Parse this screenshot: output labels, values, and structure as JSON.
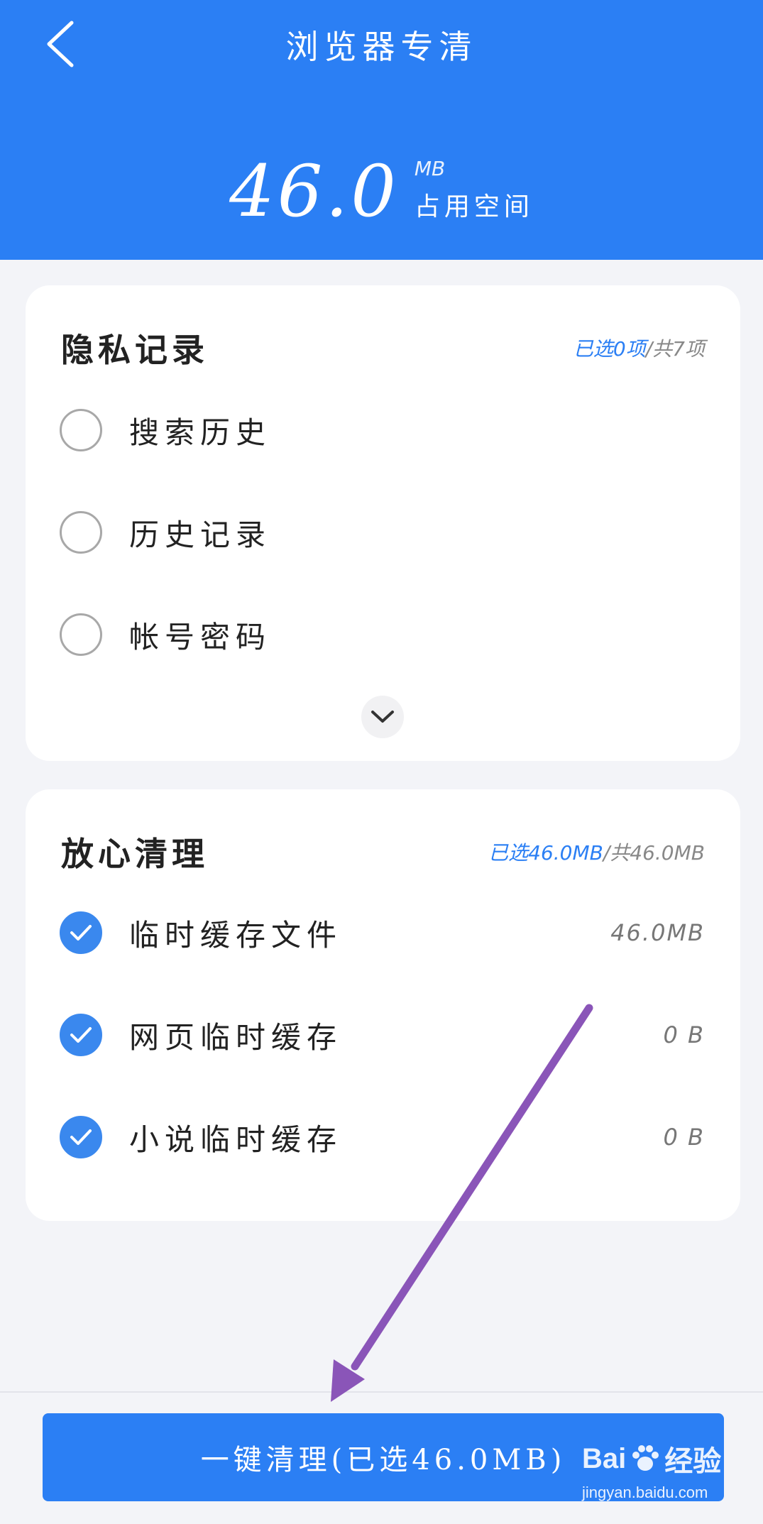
{
  "header": {
    "title": "浏览器专清",
    "size_value": "46.0",
    "size_unit": "MB",
    "size_label": "占用空间"
  },
  "privacy": {
    "title": "隐私记录",
    "selected_text": "已选0项",
    "total_text": "/共7项",
    "items": [
      {
        "label": "搜索历史",
        "checked": false
      },
      {
        "label": "历史记录",
        "checked": false
      },
      {
        "label": "帐号密码",
        "checked": false
      }
    ]
  },
  "clean": {
    "title": "放心清理",
    "selected_text": "已选46.0MB",
    "total_text": "/共46.0MB",
    "items": [
      {
        "label": "临时缓存文件",
        "size": "46.0MB",
        "checked": true
      },
      {
        "label": "网页临时缓存",
        "size": "0 B",
        "checked": true
      },
      {
        "label": "小说临时缓存",
        "size": "0 B",
        "checked": true
      }
    ]
  },
  "action": {
    "clean_button_label": "一键清理(已选46.0MB)"
  },
  "watermark": {
    "brand": "Bai",
    "brand_suffix": "经验",
    "url": "jingyan.baidu.com"
  },
  "colors": {
    "primary": "#2b7ff4",
    "check_on": "#3a88ee",
    "annotation_arrow": "#8a55b8"
  }
}
